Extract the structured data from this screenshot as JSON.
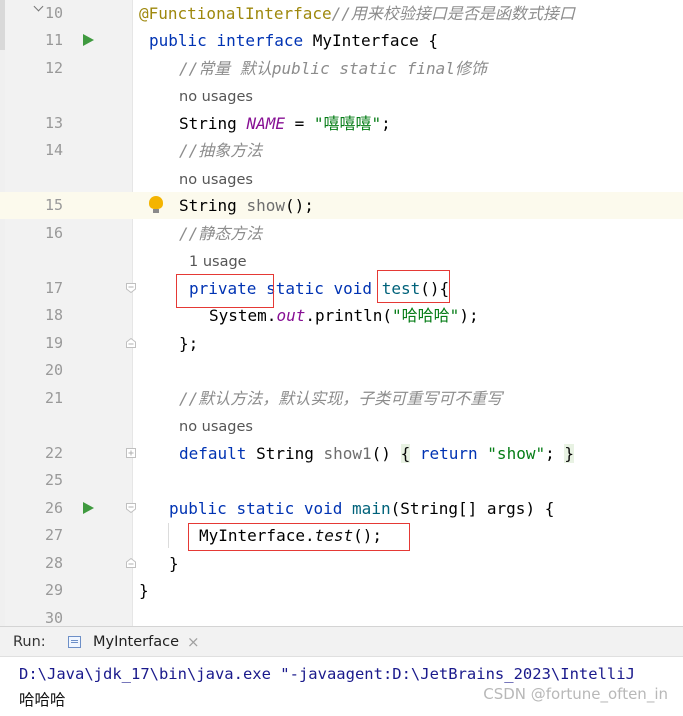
{
  "editor": {
    "lines": [
      {
        "n": "10",
        "parts": [
          [
            "ann",
            "@FunctionalInterface"
          ],
          [
            "cmt",
            "//用来校验接口是否是函数式接口"
          ]
        ]
      },
      {
        "n": "11",
        "parts": [
          [
            "kw",
            "public"
          ],
          [
            "cls",
            " "
          ],
          [
            "kw",
            "interface"
          ],
          [
            "cls",
            " MyInterface {"
          ]
        ]
      },
      {
        "n": "12",
        "parts": [
          [
            "cmt",
            "//常量 默认public static final修饰"
          ]
        ]
      },
      {
        "n": "13",
        "parts": [
          [
            "cls",
            "String "
          ],
          [
            "const",
            "NAME"
          ],
          [
            "cls",
            " = "
          ],
          [
            "str",
            "\"嘻嘻嘻\""
          ],
          [
            "cls",
            ";"
          ]
        ]
      },
      {
        "n": "14",
        "parts": [
          [
            "cmt",
            "//抽象方法"
          ]
        ]
      },
      {
        "n": "15",
        "parts": [
          [
            "cls",
            "String "
          ],
          [
            "gray",
            "show"
          ],
          [
            "cls",
            "();"
          ]
        ]
      },
      {
        "n": "16",
        "parts": [
          [
            "cmt",
            "//静态方法"
          ]
        ]
      },
      {
        "n": "17",
        "parts": [
          [
            "kw",
            "private"
          ],
          [
            "cls",
            " "
          ],
          [
            "kw",
            "static"
          ],
          [
            "cls",
            " "
          ],
          [
            "kw",
            "void"
          ],
          [
            "cls",
            " "
          ],
          [
            "meth",
            "test"
          ],
          [
            "cls",
            "(){"
          ]
        ]
      },
      {
        "n": "18",
        "parts": [
          [
            "cls",
            "System."
          ],
          [
            "const",
            "out"
          ],
          [
            "cls",
            ".println("
          ],
          [
            "str",
            "\"哈哈哈\""
          ],
          [
            "cls",
            ");"
          ]
        ]
      },
      {
        "n": "19",
        "parts": [
          [
            "cls",
            "};"
          ]
        ]
      },
      {
        "n": "20",
        "parts": []
      },
      {
        "n": "21",
        "parts": [
          [
            "cmt",
            "//默认方法，默认实现，子类可重写可不重写"
          ]
        ]
      },
      {
        "n": "22",
        "parts": [
          [
            "kw",
            "default"
          ],
          [
            "cls",
            " String "
          ],
          [
            "gray",
            "show1"
          ],
          [
            "cls",
            "() "
          ],
          [
            "bh",
            "{"
          ],
          [
            "cls",
            " "
          ],
          [
            "kw",
            "return"
          ],
          [
            "cls",
            " "
          ],
          [
            "str",
            "\"show\""
          ],
          [
            "cls",
            "; "
          ],
          [
            "bh",
            "}"
          ]
        ]
      },
      {
        "n": "25",
        "parts": []
      },
      {
        "n": "26",
        "parts": [
          [
            "kw",
            "public"
          ],
          [
            "cls",
            " "
          ],
          [
            "kw",
            "static"
          ],
          [
            "cls",
            " "
          ],
          [
            "kw",
            "void"
          ],
          [
            "cls",
            " "
          ],
          [
            "meth",
            "main"
          ],
          [
            "cls",
            "(String[] args) {"
          ]
        ]
      },
      {
        "n": "27",
        "parts": [
          [
            "cls",
            "MyInterface."
          ],
          [
            "sc",
            "test"
          ],
          [
            "cls",
            "();"
          ]
        ]
      },
      {
        "n": "28",
        "parts": [
          [
            "cls",
            "}"
          ]
        ]
      },
      {
        "n": "29",
        "parts": [
          [
            "cls",
            "}"
          ]
        ]
      },
      {
        "n": "30",
        "parts": []
      }
    ],
    "hints": {
      "h12": "no usages",
      "h14": "no usages",
      "h16": "1 usage",
      "h21": "no usages"
    }
  },
  "run_panel": {
    "label": "Run:",
    "tab_label": "MyInterface",
    "close_glyph": "×",
    "command": "D:\\Java\\jdk_17\\bin\\java.exe \"-javaagent:D:\\JetBrains_2023\\IntelliJ",
    "output": "哈哈哈"
  },
  "watermark": "CSDN @fortune_often_in",
  "colors": {
    "keyword": "#0033b3",
    "string": "#067d17",
    "comment": "#8c8c8c",
    "annotation": "#9e880d",
    "static_field": "#871094",
    "method": "#00627a",
    "highlight_box": "#e53935",
    "current_line": "#fcfaed"
  }
}
